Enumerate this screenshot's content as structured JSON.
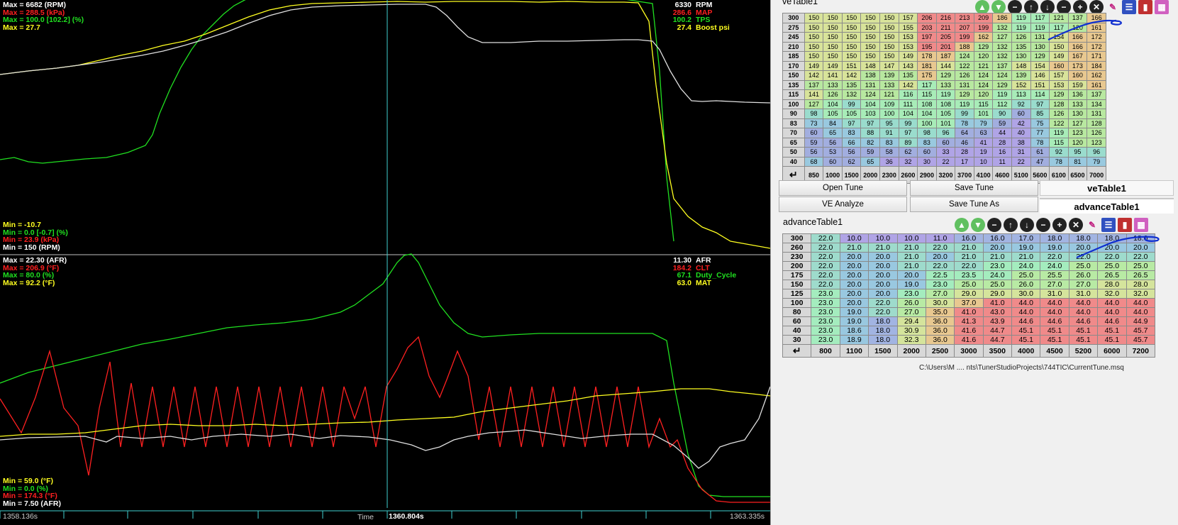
{
  "top_plot": {
    "max_labels": [
      {
        "text": "Max = 6682 (RPM)",
        "color": "#ffffff"
      },
      {
        "text": "Max = 288.5 (kPa)",
        "color": "#ff2020"
      },
      {
        "text": "Max = 100.0 [102.2] (%)",
        "color": "#20e020"
      },
      {
        "text": "Max = 27.7",
        "color": "#ffff20"
      }
    ],
    "min_labels": [
      {
        "text": "Min = -10.7",
        "color": "#ffff20"
      },
      {
        "text": "Min = 0.0 [-0.7] (%)",
        "color": "#20e020"
      },
      {
        "text": "Min = 23.9 (kPa)",
        "color": "#ff2020"
      },
      {
        "text": "Min = 150 (RPM)",
        "color": "#ffffff"
      }
    ],
    "cursor_values": [
      {
        "value": "6330",
        "name": "RPM",
        "color": "#ffffff"
      },
      {
        "value": "286.6",
        "name": "MAP",
        "color": "#ff2020"
      },
      {
        "value": "100.2",
        "name": "TPS",
        "color": "#20e020"
      },
      {
        "value": "27.4",
        "name": "Boost psi",
        "color": "#ffff20"
      }
    ]
  },
  "bottom_plot": {
    "max_labels": [
      {
        "text": "Max = 22.30 (AFR)",
        "color": "#ffffff"
      },
      {
        "text": "Max = 206.9 (°F)",
        "color": "#ff2020"
      },
      {
        "text": "Max = 80.0 (%)",
        "color": "#20e020"
      },
      {
        "text": "Max = 92.2 (°F)",
        "color": "#ffff20"
      }
    ],
    "min_labels": [
      {
        "text": "Min = 59.0 (°F)",
        "color": "#ffff20"
      },
      {
        "text": "Min = 0.0 (%)",
        "color": "#20e020"
      },
      {
        "text": "Min = 174.3 (°F)",
        "color": "#ff2020"
      },
      {
        "text": "Min = 7.50 (AFR)",
        "color": "#ffffff"
      }
    ],
    "cursor_values": [
      {
        "value": "11.30",
        "name": "AFR",
        "color": "#ffffff"
      },
      {
        "value": "184.2",
        "name": "CLT",
        "color": "#ff2020"
      },
      {
        "value": "67.1",
        "name": "Duty_Cycle",
        "color": "#20e020"
      },
      {
        "value": "63.0",
        "name": "MAT",
        "color": "#ffff20"
      }
    ]
  },
  "timeline": {
    "start": "1358.136s",
    "label": "Time",
    "cursor": "1360.804s",
    "end": "1363.335s"
  },
  "ve_table": {
    "title": "veTable1",
    "rows": [
      "300",
      "275",
      "245",
      "210",
      "185",
      "170",
      "150",
      "135",
      "115",
      "100",
      "90",
      "83",
      "70",
      "65",
      "50",
      "40"
    ],
    "cols": [
      "850",
      "1000",
      "1500",
      "2000",
      "2300",
      "2600",
      "2900",
      "3200",
      "3700",
      "4100",
      "4600",
      "5100",
      "5600",
      "6100",
      "6500",
      "7000"
    ],
    "cells": [
      [
        "150",
        "150",
        "150",
        "150",
        "150",
        "157",
        "206",
        "216",
        "213",
        "209",
        "186",
        "119",
        "117",
        "121",
        "137",
        "166"
      ],
      [
        "150",
        "150",
        "150",
        "150",
        "150",
        "155",
        "203",
        "211",
        "207",
        "199",
        "132",
        "119",
        "119",
        "117",
        "120",
        "161"
      ],
      [
        "150",
        "150",
        "150",
        "150",
        "150",
        "153",
        "197",
        "205",
        "199",
        "162",
        "127",
        "126",
        "131",
        "154",
        "166",
        "172"
      ],
      [
        "150",
        "150",
        "150",
        "150",
        "150",
        "153",
        "195",
        "201",
        "188",
        "129",
        "132",
        "135",
        "130",
        "150",
        "166",
        "172"
      ],
      [
        "150",
        "150",
        "150",
        "150",
        "150",
        "149",
        "178",
        "187",
        "124",
        "120",
        "132",
        "130",
        "129",
        "149",
        "167",
        "171"
      ],
      [
        "149",
        "149",
        "151",
        "148",
        "147",
        "143",
        "181",
        "144",
        "122",
        "121",
        "137",
        "148",
        "154",
        "160",
        "173",
        "184"
      ],
      [
        "142",
        "141",
        "142",
        "138",
        "139",
        "135",
        "175",
        "129",
        "126",
        "124",
        "124",
        "139",
        "146",
        "157",
        "160",
        "162"
      ],
      [
        "137",
        "133",
        "135",
        "131",
        "133",
        "142",
        "117",
        "133",
        "131",
        "124",
        "129",
        "152",
        "151",
        "153",
        "159",
        "161"
      ],
      [
        "141",
        "126",
        "132",
        "124",
        "121",
        "116",
        "115",
        "119",
        "129",
        "120",
        "119",
        "113",
        "114",
        "129",
        "136",
        "137"
      ],
      [
        "127",
        "104",
        "99",
        "104",
        "109",
        "111",
        "108",
        "108",
        "119",
        "115",
        "112",
        "92",
        "97",
        "128",
        "133",
        "134"
      ],
      [
        "98",
        "105",
        "105",
        "103",
        "100",
        "104",
        "104",
        "105",
        "99",
        "101",
        "90",
        "60",
        "85",
        "126",
        "130",
        "131"
      ],
      [
        "73",
        "84",
        "97",
        "97",
        "95",
        "99",
        "100",
        "101",
        "78",
        "79",
        "59",
        "42",
        "75",
        "122",
        "127",
        "128"
      ],
      [
        "60",
        "65",
        "83",
        "88",
        "91",
        "97",
        "98",
        "96",
        "64",
        "63",
        "44",
        "40",
        "77",
        "119",
        "123",
        "126"
      ],
      [
        "59",
        "56",
        "66",
        "82",
        "83",
        "89",
        "83",
        "60",
        "46",
        "41",
        "28",
        "38",
        "78",
        "115",
        "120",
        "123"
      ],
      [
        "56",
        "53",
        "56",
        "59",
        "58",
        "62",
        "60",
        "33",
        "28",
        "19",
        "16",
        "31",
        "61",
        "92",
        "95",
        "96"
      ],
      [
        "68",
        "60",
        "62",
        "65",
        "36",
        "32",
        "30",
        "22",
        "17",
        "10",
        "11",
        "22",
        "47",
        "78",
        "81",
        "79"
      ]
    ]
  },
  "buttons": {
    "open_tune": "Open Tune",
    "save_tune": "Save Tune",
    "ve_analyze": "VE Analyze",
    "save_tune_as": "Save Tune As"
  },
  "tabs": {
    "ve": "veTable1",
    "advance": "advanceTable1"
  },
  "adv_table": {
    "title": "advanceTable1",
    "rows": [
      "300",
      "260",
      "230",
      "200",
      "175",
      "150",
      "125",
      "100",
      "80",
      "60",
      "40",
      "30"
    ],
    "cols": [
      "800",
      "1100",
      "1500",
      "2000",
      "2500",
      "3000",
      "3500",
      "4000",
      "4500",
      "5200",
      "6000",
      "7200"
    ],
    "cells": [
      [
        "22.0",
        "10.0",
        "10.0",
        "10.0",
        "11.0",
        "16.0",
        "16.0",
        "17.0",
        "18.0",
        "18.0",
        "18.0",
        "18.0"
      ],
      [
        "22.0",
        "21.0",
        "21.0",
        "21.0",
        "22.0",
        "21.0",
        "20.0",
        "19.0",
        "19.0",
        "20.0",
        "20.0",
        "20.0"
      ],
      [
        "22.0",
        "20.0",
        "20.0",
        "21.0",
        "20.0",
        "21.0",
        "21.0",
        "21.0",
        "22.0",
        "22.0",
        "22.0",
        "22.0"
      ],
      [
        "22.0",
        "20.0",
        "20.0",
        "21.0",
        "22.0",
        "22.0",
        "23.0",
        "24.0",
        "24.0",
        "25.0",
        "25.0",
        "25.0"
      ],
      [
        "22.0",
        "20.0",
        "20.0",
        "20.0",
        "22.5",
        "23.5",
        "24.0",
        "25.0",
        "25.5",
        "26.0",
        "26.5",
        "26.5"
      ],
      [
        "22.0",
        "20.0",
        "20.0",
        "19.0",
        "23.0",
        "25.0",
        "25.0",
        "26.0",
        "27.0",
        "27.0",
        "28.0",
        "28.0"
      ],
      [
        "23.0",
        "20.0",
        "20.0",
        "23.0",
        "27.0",
        "29.0",
        "29.0",
        "30.0",
        "31.0",
        "31.0",
        "32.0",
        "32.0"
      ],
      [
        "23.0",
        "20.0",
        "22.0",
        "26.0",
        "30.0",
        "37.0",
        "41.0",
        "44.0",
        "44.0",
        "44.0",
        "44.0",
        "44.0"
      ],
      [
        "23.0",
        "19.0",
        "22.0",
        "27.0",
        "35.0",
        "41.0",
        "43.0",
        "44.0",
        "44.0",
        "44.0",
        "44.0",
        "44.0"
      ],
      [
        "23.0",
        "19.0",
        "18.0",
        "29.4",
        "36.0",
        "41.3",
        "43.9",
        "44.6",
        "44.6",
        "44.6",
        "44.6",
        "44.9"
      ],
      [
        "23.0",
        "18.6",
        "18.0",
        "30.9",
        "36.0",
        "41.6",
        "44.7",
        "45.1",
        "45.1",
        "45.1",
        "45.1",
        "45.7"
      ],
      [
        "23.0",
        "18.9",
        "18.0",
        "32.3",
        "36.0",
        "41.6",
        "44.7",
        "45.1",
        "45.1",
        "45.1",
        "45.1",
        "45.7"
      ]
    ]
  },
  "file_path": "C:\\Users\\M .... nts\\TunerStudioProjects\\744TIC\\CurrentTune.msq",
  "toolbar_icons": [
    "up-green-icon",
    "down-green-icon",
    "minus-icon",
    "arrow-up-icon",
    "arrow-down-icon",
    "decrease-icon",
    "increase-icon",
    "close-icon",
    "pencil-icon",
    "list-icon",
    "bars-icon",
    "gradient-icon"
  ],
  "colors": {
    "rpm": "#ffffff",
    "map": "#ff2020",
    "tps": "#20e020",
    "boost": "#ffff20",
    "cursor": "#40d0d0"
  }
}
